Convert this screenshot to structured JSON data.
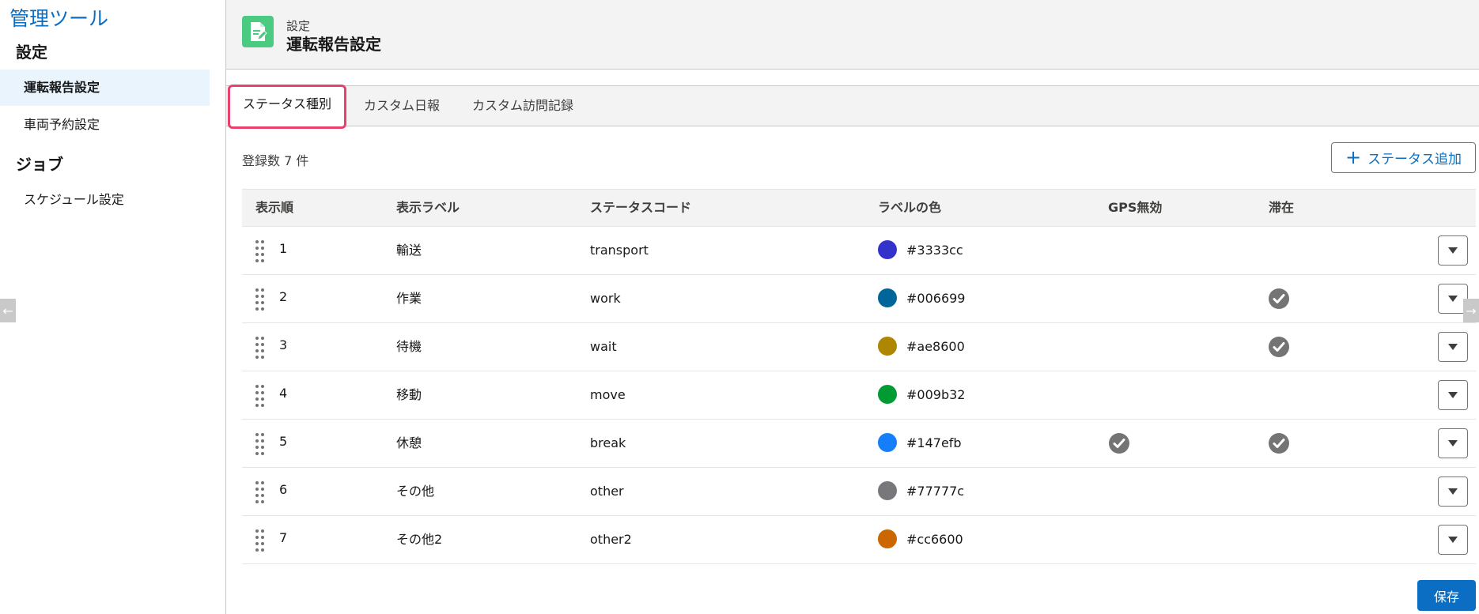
{
  "sidebar": {
    "app_title": "管理ツール",
    "sections": [
      {
        "title": "設定",
        "items": [
          "運転報告設定",
          "車両予約設定"
        ]
      },
      {
        "title": "ジョブ",
        "items": [
          "スケジュール設定"
        ]
      }
    ]
  },
  "header": {
    "super_title": "設定",
    "title": "運転報告設定"
  },
  "tabs": [
    "ステータス種別",
    "カスタム日報",
    "カスタム訪問記録"
  ],
  "summary": {
    "count_text": "登録数 7 件",
    "add_button": "ステータス追加"
  },
  "table": {
    "headers": [
      "表示順",
      "表示ラベル",
      "ステータスコード",
      "ラベルの色",
      "GPS無効",
      "滞在"
    ],
    "rows": [
      {
        "order": "1",
        "label": "輸送",
        "code": "transport",
        "color": "#3333cc",
        "gps_disabled": false,
        "stay": false
      },
      {
        "order": "2",
        "label": "作業",
        "code": "work",
        "color": "#006699",
        "gps_disabled": false,
        "stay": true
      },
      {
        "order": "3",
        "label": "待機",
        "code": "wait",
        "color": "#ae8600",
        "gps_disabled": false,
        "stay": true
      },
      {
        "order": "4",
        "label": "移動",
        "code": "move",
        "color": "#009b32",
        "gps_disabled": false,
        "stay": false
      },
      {
        "order": "5",
        "label": "休憩",
        "code": "break",
        "color": "#147efb",
        "gps_disabled": true,
        "stay": true
      },
      {
        "order": "6",
        "label": "その他",
        "code": "other",
        "color": "#77777c",
        "gps_disabled": false,
        "stay": false
      },
      {
        "order": "7",
        "label": "その他2",
        "code": "other2",
        "color": "#cc6600",
        "gps_disabled": false,
        "stay": false
      }
    ]
  },
  "save_button": "保存",
  "colors": {
    "accent": "#0b6ec2",
    "active_tab_border": "#e8416e",
    "header_icon": "#4bca81"
  }
}
